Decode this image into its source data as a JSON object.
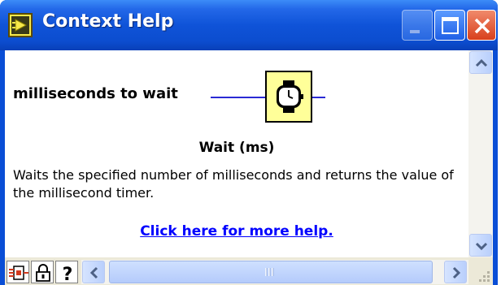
{
  "window": {
    "title": "Context Help",
    "app_icon": "labview-icon",
    "controls": [
      "minimize",
      "maximize",
      "close"
    ]
  },
  "diagram": {
    "terminal_label": "milliseconds to wait",
    "node_icon": "wristwatch-icon",
    "node_color": "#ffff99",
    "wire_color": "#2a2ad4"
  },
  "help": {
    "function_name": "Wait (ms)",
    "description": "Waits the specified number of milliseconds and returns the value of the millisecond timer.",
    "link_text": "Click here for more help.",
    "link_color": "#0000ff"
  },
  "toolbar": {
    "tools": [
      "show-optional-terminals-icon",
      "lock-icon",
      "help-question-icon"
    ],
    "scroll_grip_label": "III"
  },
  "colors": {
    "titlebar": "#0c4dcf",
    "close_button": "#d8401c",
    "frame": "#ece9d8"
  }
}
